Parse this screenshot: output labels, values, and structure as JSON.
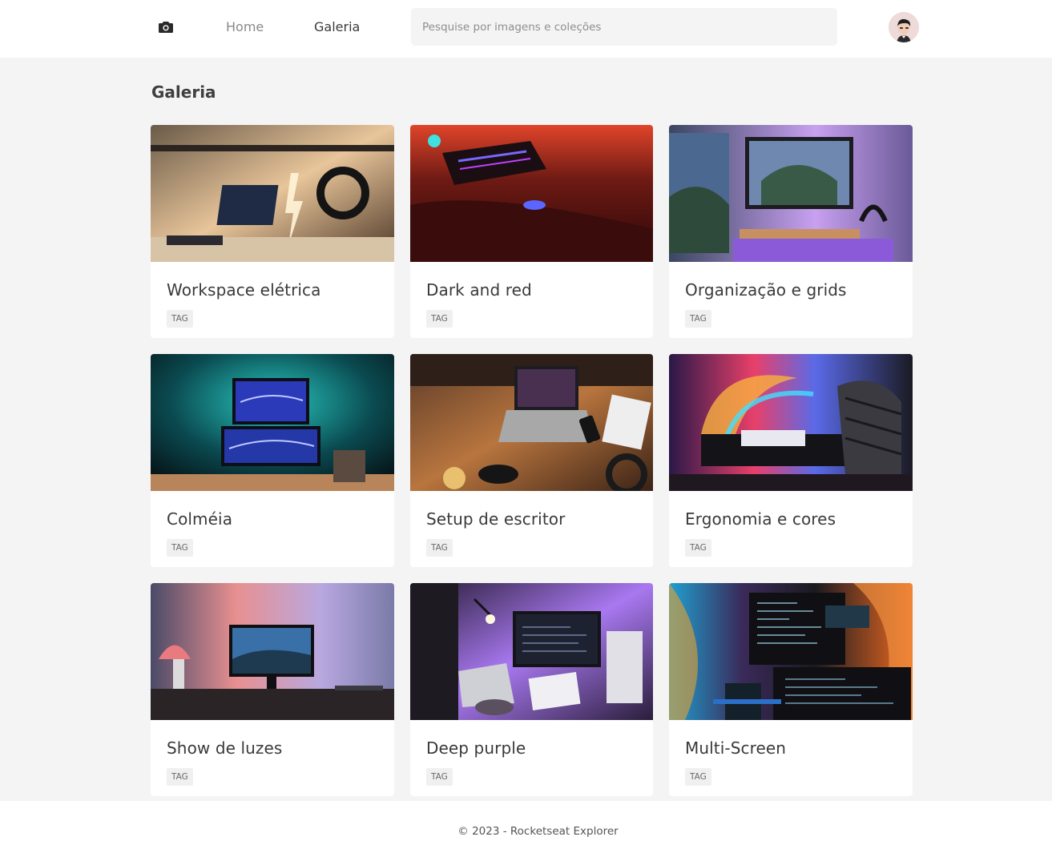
{
  "header": {
    "logo_icon": "camera-icon",
    "nav": [
      {
        "label": "Home",
        "active": false
      },
      {
        "label": "Galeria",
        "active": true
      }
    ],
    "search": {
      "placeholder": "Pesquise por imagens e coleções",
      "value": ""
    },
    "avatar_icon": "user-avatar"
  },
  "page": {
    "title": "Galeria"
  },
  "cards": [
    {
      "title": "Workspace elétrica",
      "tag": "TAG",
      "palette": [
        "#3b2c20",
        "#f2c070",
        "#8a6a48"
      ]
    },
    {
      "title": "Dark and red",
      "tag": "TAG",
      "palette": [
        "#2a0a08",
        "#d8402a",
        "#5a1a18"
      ]
    },
    {
      "title": "Organização e grids",
      "tag": "TAG",
      "palette": [
        "#3a4a78",
        "#c070e0",
        "#2a2a3a"
      ]
    },
    {
      "title": "Colméia",
      "tag": "TAG",
      "palette": [
        "#062a30",
        "#1fb0a8",
        "#2a3aa0"
      ]
    },
    {
      "title": "Setup de escritor",
      "tag": "TAG",
      "palette": [
        "#4a2a18",
        "#c07a40",
        "#1a1a1a"
      ]
    },
    {
      "title": "Ergonomia e cores",
      "tag": "TAG",
      "palette": [
        "#3a1a4a",
        "#e84a70",
        "#2a2a3a"
      ]
    },
    {
      "title": "Show de luzes",
      "tag": "TAG",
      "palette": [
        "#5a5070",
        "#e0a0b0",
        "#2a2a30"
      ]
    },
    {
      "title": "Deep purple",
      "tag": "TAG",
      "palette": [
        "#3a2a5a",
        "#b080f0",
        "#1a1a22"
      ]
    },
    {
      "title": "Multi-Screen",
      "tag": "TAG",
      "palette": [
        "#102a30",
        "#f07a30",
        "#2a3a5a"
      ]
    }
  ],
  "footer": {
    "text": "© 2023 - Rocketseat Explorer"
  }
}
